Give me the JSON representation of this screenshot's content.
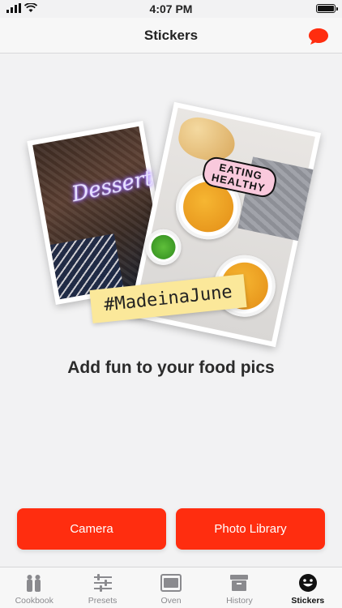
{
  "status_bar": {
    "time": "4:07 PM"
  },
  "nav": {
    "title": "Stickers"
  },
  "hero": {
    "sticker_dessert": "Dessert",
    "sticker_healthy_line1": "EATING",
    "sticker_healthy_line2": "HEALTHY",
    "sticker_june": "#MadeinaJune"
  },
  "tagline": "Add fun to your food pics",
  "buttons": {
    "camera": "Camera",
    "library": "Photo Library"
  },
  "tabs": [
    {
      "label": "Cookbook",
      "icon": "salt-pepper-icon"
    },
    {
      "label": "Presets",
      "icon": "sliders-icon"
    },
    {
      "label": "Oven",
      "icon": "oven-icon"
    },
    {
      "label": "History",
      "icon": "archive-box-icon"
    },
    {
      "label": "Stickers",
      "icon": "smiley-icon",
      "active": true
    }
  ],
  "colors": {
    "accent": "#ff2d0f",
    "background": "#f2f2f3",
    "tab_inactive": "#8a8a8e"
  }
}
